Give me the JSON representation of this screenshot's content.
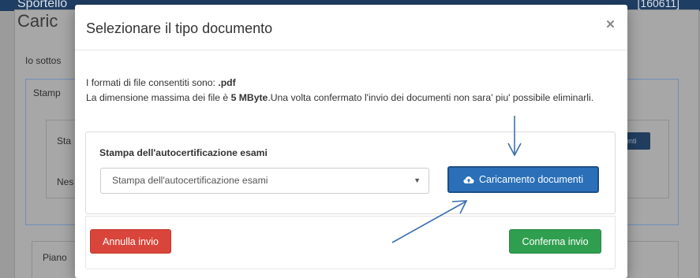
{
  "background": {
    "topbar_left": "Sportello",
    "topbar_right": "[160611]",
    "card_title": "Caric",
    "intro_text": "Io sottos",
    "panel1_title": "Stamp",
    "cell_1": "Sta",
    "cell_2": "Nes",
    "right_button": "enti",
    "panel2_title": "Piano"
  },
  "modal": {
    "title": "Selezionare il tipo documento",
    "close_glyph": "×",
    "info": {
      "formats_prefix": "I formati di file consentiti sono: ",
      "formats_value": ".pdf",
      "size_prefix": "La dimensione massima dei file è ",
      "size_value": "5 MByte",
      "size_suffix": ".Una volta confermato l'invio dei documenti non sara' piu' possibile eliminarli."
    },
    "doc_panel": {
      "title": "Stampa dell'autocertificazione esami",
      "select_value": "Stampa dell'autocertificazione esami",
      "upload_button_label": "Caricamento documenti"
    },
    "footer": {
      "cancel_label": "Annulla invio",
      "confirm_label": "Conferma invio"
    }
  },
  "colors": {
    "upload_button": "#2a6fb8",
    "cancel_button": "#d9453a",
    "confirm_button": "#2f9f4f",
    "annotation_arrow": "#3b6fb0",
    "topbar": "#1f3e63"
  },
  "icons": {
    "upload": "cloud-upload-icon",
    "select_caret": "caret-down-icon",
    "close": "close-icon"
  }
}
